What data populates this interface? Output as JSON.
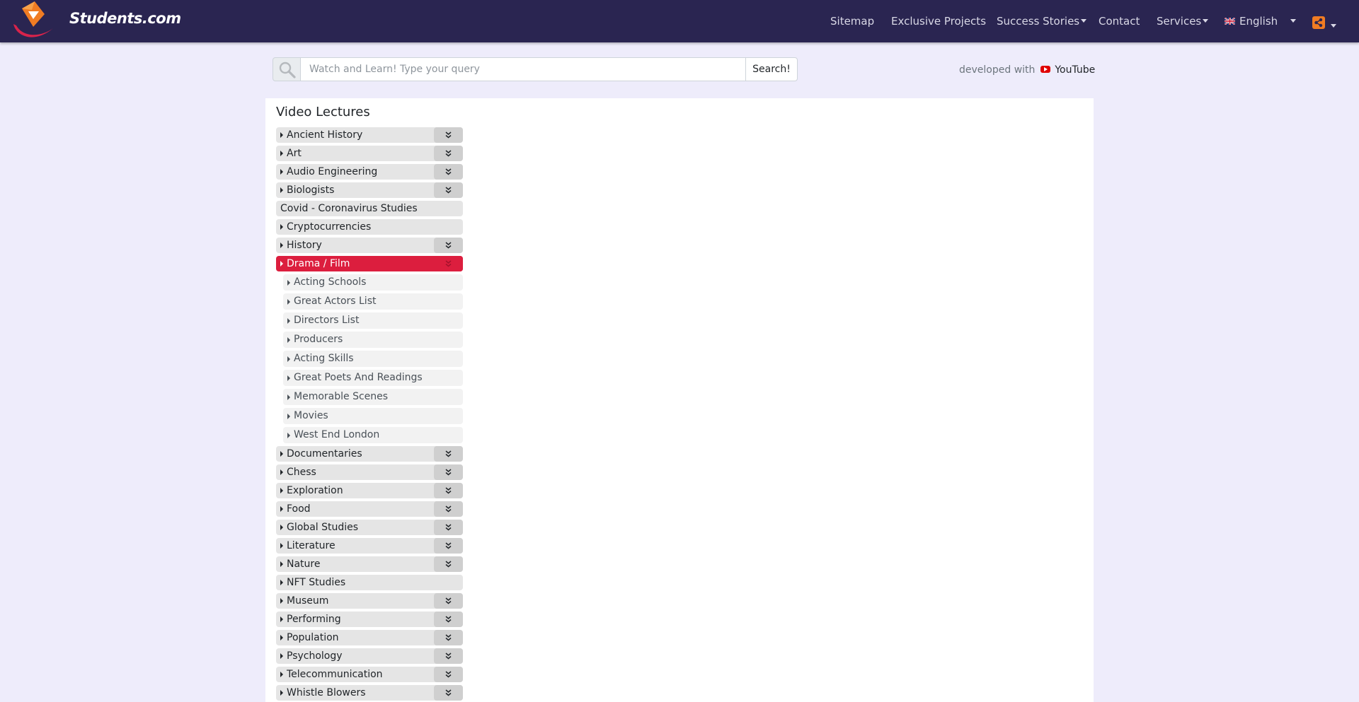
{
  "brand": {
    "name": "Students.com",
    "colors": {
      "navbar": "#2a2551",
      "accent": "#dc1e3e",
      "logo_orange": "#f07c23",
      "logo_red": "#d8234b"
    }
  },
  "nav": {
    "items": [
      {
        "label": "Sitemap",
        "dropdown": false
      },
      {
        "label": "Exclusive Projects",
        "dropdown": false
      },
      {
        "label": "Success Stories",
        "dropdown": true
      },
      {
        "label": "Contact",
        "dropdown": false
      },
      {
        "label": "Services",
        "dropdown": true
      }
    ],
    "language": {
      "label": "English",
      "icon": "uk-flag-icon"
    },
    "share_icon": "share-icon"
  },
  "search": {
    "placeholder": "Watch and Learn! Type your query",
    "value": "",
    "button_label": "Search!",
    "icon": "search-icon"
  },
  "developed_with": {
    "text": "developed with",
    "brand": "YouTube"
  },
  "panel": {
    "title": "Video Lectures",
    "categories": [
      {
        "label": "Ancient History",
        "arrow": true,
        "toggle": true
      },
      {
        "label": "Art",
        "arrow": true,
        "toggle": true
      },
      {
        "label": "Audio Engineering",
        "arrow": true,
        "toggle": true
      },
      {
        "label": "Biologists",
        "arrow": true,
        "toggle": true
      },
      {
        "label": "Covid - Coronavirus Studies",
        "arrow": false,
        "toggle": false
      },
      {
        "label": "Cryptocurrencies",
        "arrow": true,
        "toggle": false
      },
      {
        "label": "History",
        "arrow": true,
        "toggle": true
      },
      {
        "label": "Drama / Film",
        "arrow": true,
        "toggle": true,
        "active": true,
        "subcategories": [
          "Acting Schools",
          "Great Actors List",
          "Directors List",
          "Producers",
          "Acting Skills",
          "Great Poets And Readings",
          "Memorable Scenes",
          "Movies",
          "West End London"
        ]
      },
      {
        "label": "Documentaries",
        "arrow": true,
        "toggle": true
      },
      {
        "label": "Chess",
        "arrow": true,
        "toggle": true
      },
      {
        "label": "Exploration",
        "arrow": true,
        "toggle": true
      },
      {
        "label": "Food",
        "arrow": true,
        "toggle": true
      },
      {
        "label": "Global Studies",
        "arrow": true,
        "toggle": true
      },
      {
        "label": "Literature",
        "arrow": true,
        "toggle": true
      },
      {
        "label": "Nature",
        "arrow": true,
        "toggle": true
      },
      {
        "label": "NFT Studies",
        "arrow": true,
        "toggle": false
      },
      {
        "label": "Museum",
        "arrow": true,
        "toggle": true
      },
      {
        "label": "Performing",
        "arrow": true,
        "toggle": true
      },
      {
        "label": "Population",
        "arrow": true,
        "toggle": true
      },
      {
        "label": "Psychology",
        "arrow": true,
        "toggle": true
      },
      {
        "label": "Telecommunication",
        "arrow": true,
        "toggle": true
      },
      {
        "label": "Whistle Blowers",
        "arrow": true,
        "toggle": true
      }
    ]
  }
}
